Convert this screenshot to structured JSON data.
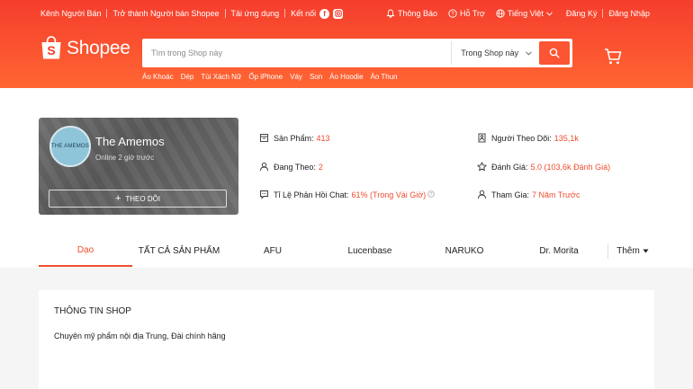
{
  "topbar": {
    "left": [
      "Kênh Người Bán",
      "Trở thành Người bán Shopee",
      "Tải ứng dụng",
      "Kết nối"
    ],
    "notifications": "Thông Báo",
    "support": "Hỗ Trợ",
    "language": "Tiếng Việt",
    "register": "Đăng Ký",
    "login": "Đăng Nhập"
  },
  "header": {
    "logo_text": "Shopee",
    "logo_letter": "S",
    "search_placeholder": "Tìm trong Shop này",
    "search_scope": "Trong Shop này",
    "keywords": [
      "Áo Khoác",
      "Dép",
      "Túi Xách Nữ",
      "Ốp iPhone",
      "Váy",
      "Son",
      "Áo Hoodie",
      "Áo Thun"
    ],
    "colors": {
      "brand": "#ee4d2d",
      "gradient_start": "#f53d2d",
      "gradient_end": "#ff6633"
    }
  },
  "shop": {
    "avatar_text": "THE AMEMOS",
    "name": "The Amemos",
    "status": "Online 2 giờ trước",
    "follow_label": "THEO DÕI",
    "stats": {
      "products": {
        "label": "Sản Phẩm:",
        "value": "413"
      },
      "following": {
        "label": "Đang Theo:",
        "value": "2"
      },
      "chat_rate": {
        "label": "Tỉ Lệ Phản Hồi Chat:",
        "value": "61% (Trong Vài Giờ)"
      },
      "followers": {
        "label": "Người Theo Dõi:",
        "value": "135,1k"
      },
      "rating": {
        "label": "Đánh Giá:",
        "value": "5.0 (103,6k Đánh Giá)"
      },
      "joined": {
        "label": "Tham Gia:",
        "value": "7 Năm Trước"
      }
    }
  },
  "tabs": {
    "items": [
      "Dạo",
      "TẤT CẢ SẢN PHẨM",
      "AFU",
      "Lucenbase",
      "NARUKO",
      "Dr. Morita"
    ],
    "more": "Thêm",
    "active_index": 0
  },
  "info": {
    "title": "THÔNG TIN SHOP",
    "description": "Chuyên mỹ phẩm nội địa Trung, Đài chính hãng"
  }
}
